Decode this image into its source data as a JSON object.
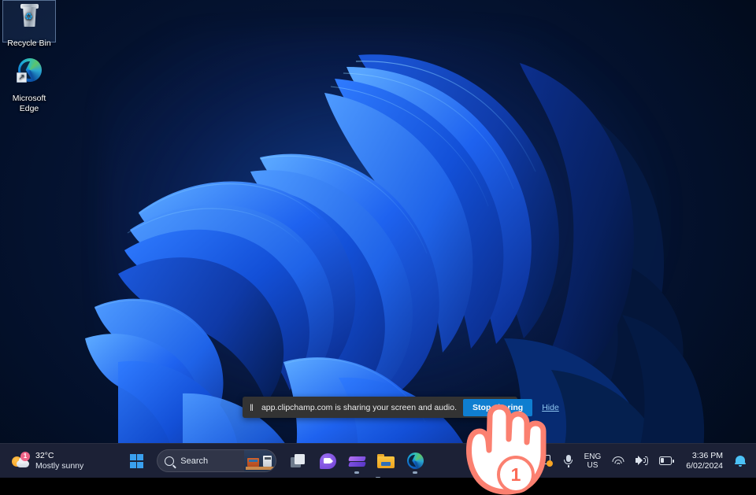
{
  "desktop": {
    "icons": [
      {
        "name": "recycle-bin",
        "label": "Recycle Bin",
        "selected": true
      },
      {
        "name": "microsoft-edge",
        "label_line1": "Microsoft",
        "label_line2": "Edge",
        "selected": false
      }
    ]
  },
  "share_bar": {
    "pause_glyph": "‖",
    "message": "app.clipchamp.com is sharing your screen and audio.",
    "stop_label": "Stop sharing",
    "hide_label": "Hide",
    "button_color": "#0f7ed0",
    "background_color": "#333333"
  },
  "taskbar": {
    "background_color": "#1c2136",
    "weather": {
      "temperature": "32°C",
      "condition": "Mostly sunny",
      "badge_count": "1",
      "badge_color": "#f06387",
      "icon": "sun-behind-cloud-icon"
    },
    "start": {
      "icon": "windows-logo-icon",
      "label": "Start"
    },
    "search": {
      "placeholder": "Search",
      "icon": "search-icon",
      "thumbnail": "search-highlight-thumbnail"
    },
    "apps": [
      {
        "name": "task-view",
        "icon": "task-view-icon",
        "running": false
      },
      {
        "name": "chat",
        "icon": "chat-icon",
        "running": false
      },
      {
        "name": "clipchamp",
        "icon": "clipchamp-icon",
        "running": true
      },
      {
        "name": "file-explorer",
        "icon": "folder-icon",
        "running": false
      },
      {
        "name": "microsoft-edge",
        "icon": "edge-icon",
        "running": true
      }
    ],
    "tray": {
      "screen_share_active": {
        "icon": "screen-share-active-icon"
      },
      "overflow": {
        "icon": "chevron-up-icon"
      },
      "recording": {
        "icon": "screen-record-icon"
      },
      "microphone": {
        "icon": "microphone-icon"
      },
      "language": {
        "line1": "ENG",
        "line2": "US"
      },
      "wifi": {
        "icon": "wifi-icon"
      },
      "volume": {
        "icon": "speaker-icon"
      },
      "battery": {
        "icon": "battery-icon"
      },
      "clock": {
        "time": "3:36 PM",
        "date": "6/02/2024"
      },
      "notifications": {
        "icon": "bell-icon",
        "color": "#4cc2f7"
      }
    }
  },
  "annotation": {
    "cursor": "pointing-hand-cursor",
    "step_number": "1",
    "accent_color": "#fb8070"
  }
}
